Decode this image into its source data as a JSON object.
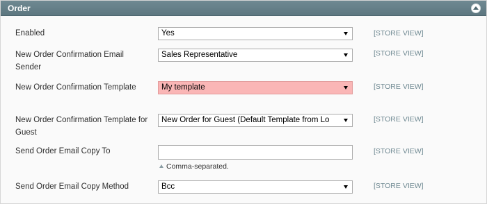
{
  "section": {
    "title": "Order",
    "collapse_icon": "arrow-up-circle-icon"
  },
  "rows": [
    {
      "label": "Enabled",
      "value": "Yes",
      "scope": "[STORE VIEW]",
      "type": "select"
    },
    {
      "label": "New Order Confirmation Email Sender",
      "value": "Sales Representative",
      "scope": "[STORE VIEW]",
      "type": "select"
    },
    {
      "label": "New Order Confirmation Template",
      "value": "My template",
      "scope": "[STORE VIEW]",
      "type": "select",
      "state": "error",
      "state_color": "#fab6b6"
    },
    {
      "label": "New Order Confirmation Template for Guest",
      "value": "New Order for Guest (Default Template from Lo",
      "scope": "[STORE VIEW]",
      "type": "select"
    },
    {
      "label": "Send Order Email Copy To",
      "value": "",
      "scope": "[STORE VIEW]",
      "type": "text",
      "note": "Comma-separated."
    },
    {
      "label": "Send Order Email Copy Method",
      "value": "Bcc",
      "scope": "[STORE VIEW]",
      "type": "select"
    }
  ],
  "colors": {
    "header_bg": "#6f8992",
    "scope_text": "#6f8992",
    "error_bg": "#fab6b6"
  }
}
